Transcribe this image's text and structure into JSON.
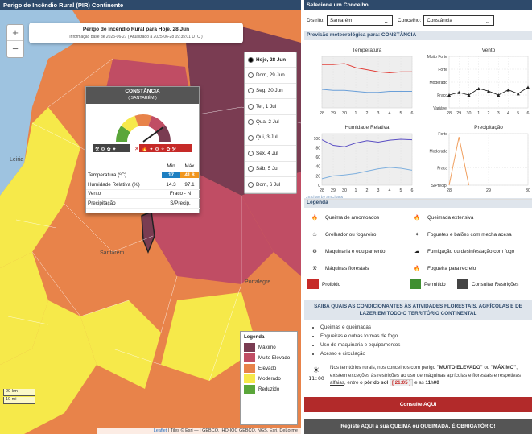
{
  "left_header": "Perigo de Incêndio Rural (PIR) Continente",
  "map": {
    "zoom_in": "+",
    "zoom_out": "−",
    "title": "Perigo de Incêndio Rural para Hoje, 28 Jun",
    "subtitle": "Informação base de 2025-06-27 ( Atualizado a 2025-06-28 09:35:01 UTC )",
    "labels": {
      "leiria": "Leiria",
      "santarem": "Santarém",
      "portalegre": "Portalegre"
    },
    "days": [
      "Hoje, 28 Jun",
      "Dom, 29 Jun",
      "Seg, 30 Jun",
      "Ter, 1 Jul",
      "Qua, 2 Jul",
      "Qui, 3 Jul",
      "Sex, 4 Jul",
      "Sáb, 5 Jul",
      "Dom, 6 Jul"
    ],
    "selected_day": 0,
    "popup": {
      "title": "CONSTÂNCIA",
      "subtitle": "( SANTARÉM )",
      "col_min": "Min",
      "col_max": "Máx",
      "rows": [
        {
          "label": "Temperatura (ºC)",
          "min": "17",
          "max": "41.8"
        },
        {
          "label": "Humidade Relativa (%)",
          "min": "14.3",
          "max": "97.1"
        },
        {
          "label": "Vento",
          "value": "Fraco - N"
        },
        {
          "label": "Precipitação",
          "value": "S/Precip."
        }
      ],
      "gauge_level": 0.8
    },
    "legend": {
      "title": "Legenda",
      "items": [
        {
          "label": "Máximo",
          "color": "#7a3c52"
        },
        {
          "label": "Muito Elevado",
          "color": "#c04d64"
        },
        {
          "label": "Elevado",
          "color": "#e8834a"
        },
        {
          "label": "Moderado",
          "color": "#f6e94a"
        },
        {
          "label": "Reduzido",
          "color": "#5aa63a"
        }
      ]
    },
    "scale": [
      "20 km",
      "10 mi"
    ],
    "attribution_leaflet": "Leaflet",
    "attribution_rest": " | Tiles © Esri — | GEBCO, IHO-IOC GEBCO, NGS, Esri, DeLorme"
  },
  "right": {
    "header": "Selecione um Concelho",
    "distrito_label": "Distrito:",
    "distrito_value": "Santarém",
    "concelho_label": "Concelho:",
    "concelho_value": "Constância",
    "forecast_header": "Previsão meteorológica para: CONSTÂNCIA",
    "amcharts": "JS chart by amCharts",
    "legend_header": "Legenda",
    "legend_items": [
      "Queima de amontoados",
      "Queimada extensiva",
      "Grelhador ou fogareiro",
      "Foguetes e balões com mecha acesa",
      "Maquinaria e equipamento",
      "Fumigação ou desinfestação com fogo",
      "Máquinas florestais",
      "Fogueira para recreio"
    ],
    "status": [
      {
        "label": "Proibido",
        "color": "#c62a28"
      },
      {
        "label": "Permitido",
        "color": "#3f8f30"
      },
      {
        "label": "Consultar Restrições",
        "color": "#444444"
      }
    ],
    "info_header": "SAIBA QUAIS AS CONDICIONANTES ÀS ATIVIDADES FLORESTAIS, AGRÍCOLAS E DE LAZER EM TODO O TERRITÓRIO CONTINENTAL",
    "info_items": [
      "Queimas e queimadas",
      "Fogueiras e outras formas de fogo",
      "Uso de maquinaria e equipamentos",
      "Acesso e circulação"
    ],
    "notice_pre": "Nos territórios rurais, nos concelhos com perigo ",
    "notice_me": "\"MUITO ELEVADO\"",
    "notice_ou": " ou ",
    "notice_max": "\"MÁXIMO\"",
    "notice_mid": ", existem exceções às restrições ao uso de máquinas ",
    "notice_link1": "agrícolas e florestais",
    "notice_mid2": " e respetivas ",
    "notice_link2": "alfaias",
    "notice_mid3": ", entre o ",
    "notice_sunset": "pôr do sol",
    "notice_time": "[ 21:05 ]",
    "notice_end": " e as ",
    "notice_11": "11h00",
    "clock_label": "11:00",
    "btn_consult": "Consulte AQUI",
    "btn_register": "Registe AQUI a sua QUEIMA ou QUEIMADA. É OBRIGATÓRIO!"
  },
  "charts": [
    {
      "title": "Temperatura",
      "type": "line",
      "x": [
        "28",
        "29",
        "30",
        "1",
        "2",
        "3",
        "4",
        "5",
        "6"
      ],
      "series": [
        {
          "values": [
            42,
            42,
            43,
            39,
            37,
            35,
            34,
            35,
            35
          ],
          "color": "#e2403a"
        },
        {
          "values": [
            18,
            17,
            17,
            16,
            15,
            15,
            16,
            16,
            16
          ],
          "color": "#6a9fd8"
        }
      ],
      "ylim": [
        0,
        50
      ]
    },
    {
      "title": "Vento",
      "type": "line",
      "x": [
        "28",
        "29",
        "30",
        "1",
        "2",
        "3",
        "4",
        "5",
        "6"
      ],
      "categories_y": [
        "Muito Forte",
        "Forte",
        "Moderado",
        "Fraco",
        "Variável"
      ],
      "series": [
        {
          "values": [
            1,
            1.2,
            1,
            1.5,
            1.3,
            1,
            1.4,
            1.1,
            1.6
          ],
          "color": "#222222"
        }
      ]
    },
    {
      "title": "Humidade Relativa",
      "type": "line",
      "x": [
        "28",
        "29",
        "30",
        "1",
        "2",
        "3",
        "4",
        "5",
        "6"
      ],
      "yticks": [
        "0",
        "20",
        "40",
        "60",
        "80",
        "100"
      ],
      "series": [
        {
          "values": [
            97,
            85,
            82,
            90,
            95,
            92,
            96,
            98,
            97
          ],
          "color": "#5b4fc4"
        },
        {
          "values": [
            14,
            20,
            22,
            25,
            30,
            35,
            38,
            36,
            32
          ],
          "color": "#7fb0de"
        }
      ],
      "ylim": [
        0,
        110
      ]
    },
    {
      "title": "Precipitação",
      "type": "line",
      "x": [
        "28",
        "29",
        "30"
      ],
      "categories_y": [
        "Forte",
        "Moderada",
        "Fraca",
        "S/Precip."
      ],
      "series": [
        {
          "values": [
            0,
            2.8,
            0
          ],
          "color": "#f0a060"
        }
      ]
    }
  ]
}
